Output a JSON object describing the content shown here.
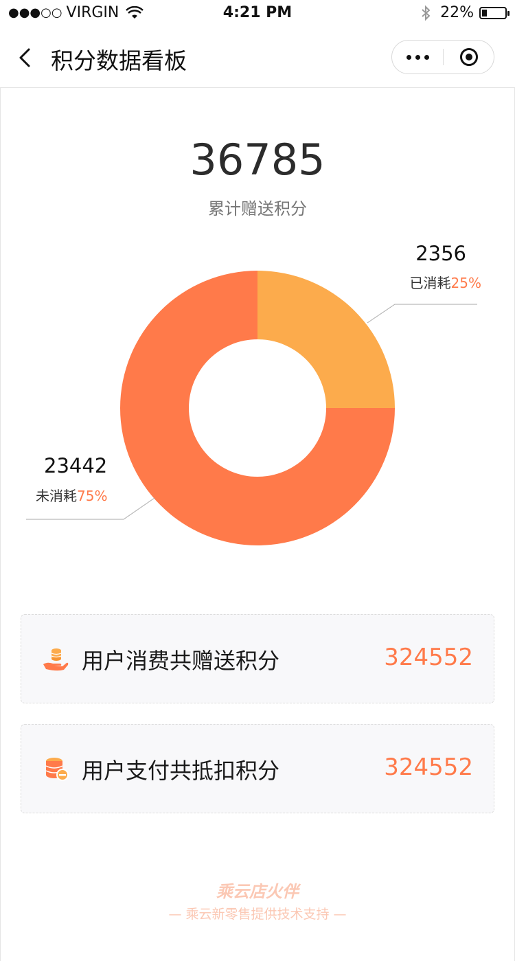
{
  "status_bar": {
    "signal": "●●●○○",
    "carrier": "VIRGIN",
    "time": "4:21 PM",
    "battery_text": "22%",
    "battery_level": 0.22
  },
  "nav": {
    "title": "积分数据看板",
    "back_icon": "chevron-left-icon",
    "more_icon": "more-dots-icon",
    "close_icon": "target-close-icon"
  },
  "summary": {
    "total_value": "36785",
    "total_label": "累计赠送积分"
  },
  "chart_data": {
    "type": "pie",
    "donut": true,
    "slices": [
      {
        "name": "已消耗",
        "value": 2356,
        "percent": 25,
        "color": "#fcab4c"
      },
      {
        "name": "未消耗",
        "value": 23442,
        "percent": 75,
        "color": "#ff7a4a"
      }
    ],
    "labels": {
      "consumed": {
        "value": "2356",
        "text": "已消耗",
        "percent": "25%"
      },
      "unconsumed": {
        "value": "23442",
        "text": "未消耗",
        "percent": "75%"
      }
    }
  },
  "cards": [
    {
      "icon": "coin-hand-icon",
      "label": "用户消费共赠送积分",
      "value": "324552"
    },
    {
      "icon": "coin-stack-minus-icon",
      "label": "用户支付共抵扣积分",
      "value": "324552"
    }
  ],
  "footer": {
    "brand": "乘云店火伴",
    "support": "— 乘云新零售提供技术支持 —"
  },
  "colors": {
    "accent": "#ff7a4a",
    "secondary": "#fcab4c",
    "footer": "#fbc8b4"
  }
}
